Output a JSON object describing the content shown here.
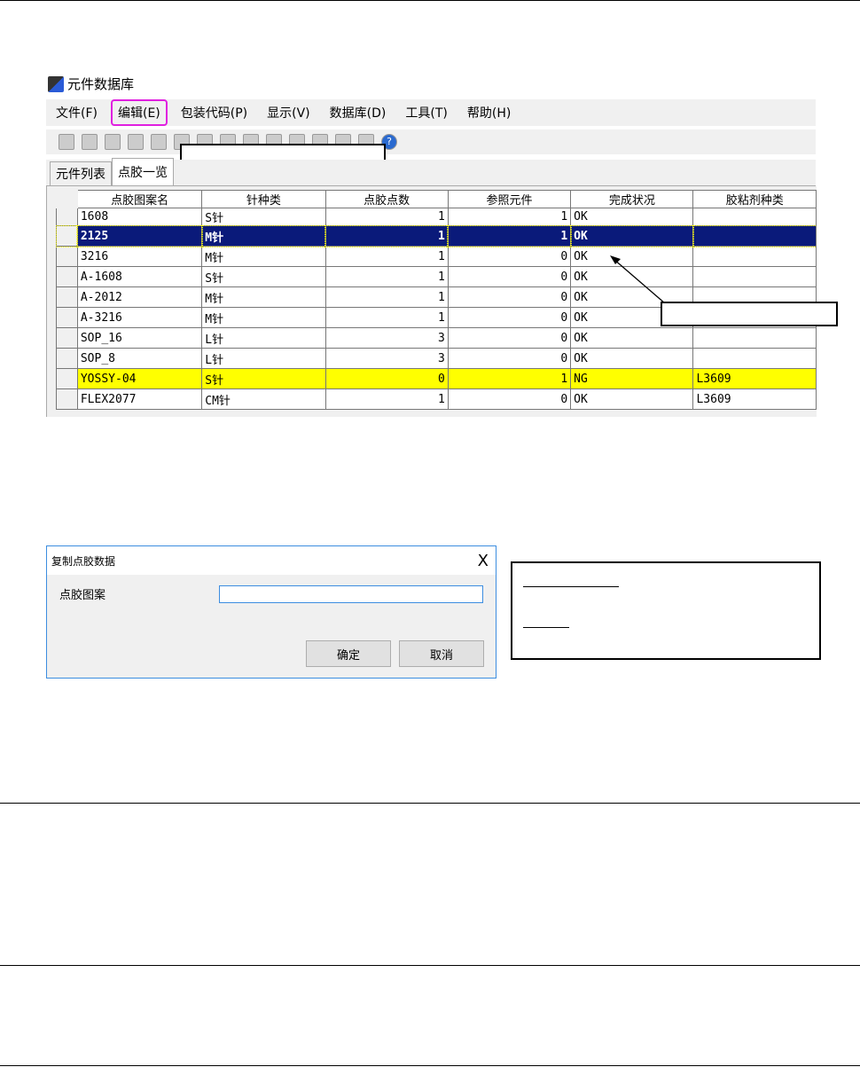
{
  "app": {
    "title": "元件数据库"
  },
  "menu": [
    "文件(F)",
    "编辑(E)",
    "包装代码(P)",
    "显示(V)",
    "数据库(D)",
    "工具(T)",
    "帮助(H)"
  ],
  "toolbar_icons": [
    "new-icon",
    "print-icon",
    "undo-icon",
    "add-icon",
    "copy-icon",
    "cut-icon",
    "up-icon",
    "down-icon",
    "find-icon",
    "find-prev-icon",
    "find-next-icon",
    "add-green-icon",
    "refresh-icon",
    "preview-icon",
    "help-icon"
  ],
  "tabs": [
    "元件列表",
    "点胶一览"
  ],
  "table": {
    "columns": [
      "点胶图案名",
      "针种类",
      "点胶点数",
      "参照元件",
      "完成状况",
      "胶粘剂种类"
    ],
    "rows": [
      [
        "1608",
        "S针",
        "1",
        "1",
        "OK",
        ""
      ],
      [
        "2125",
        "M针",
        "1",
        "1",
        "OK",
        ""
      ],
      [
        "3216",
        "M针",
        "1",
        "0",
        "OK",
        ""
      ],
      [
        "A-1608",
        "S针",
        "1",
        "0",
        "OK",
        ""
      ],
      [
        "A-2012",
        "M针",
        "1",
        "0",
        "OK",
        ""
      ],
      [
        "A-3216",
        "M针",
        "1",
        "0",
        "OK",
        ""
      ],
      [
        "SOP_16",
        "L针",
        "3",
        "0",
        "OK",
        ""
      ],
      [
        "SOP_8",
        "L针",
        "3",
        "0",
        "OK",
        ""
      ],
      [
        "YOSSY-04",
        "S针",
        "0",
        "1",
        "NG",
        "L3609"
      ],
      [
        "FLEX2077",
        "CM针",
        "1",
        "0",
        "OK",
        "L3609"
      ]
    ],
    "selected_row": 1,
    "ng_row": 8
  },
  "dialog": {
    "title": "复制点胶数据",
    "close": "X",
    "field_label": "点胶图案",
    "field_value": "",
    "ok": "确定",
    "cancel": "取消"
  },
  "colors": {
    "highlight": "#e020e0",
    "selection": "#0a1a7a",
    "ng": "#ffff00",
    "dialog_border": "#3c8de0"
  }
}
